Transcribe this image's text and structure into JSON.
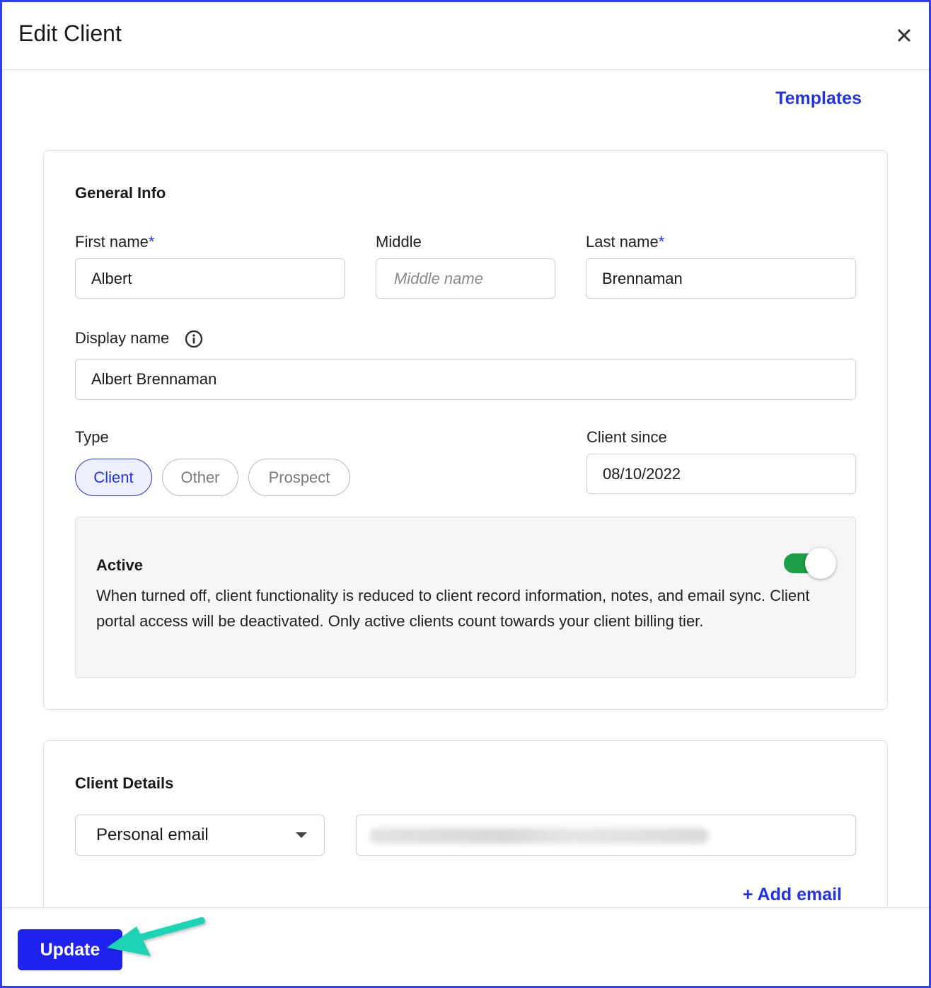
{
  "dialog": {
    "title": "Edit Client",
    "close_icon": "close-icon"
  },
  "templates_link": "Templates",
  "general_info": {
    "title": "General Info",
    "first_name": {
      "label": "First name",
      "required_mark": "*",
      "value": "Albert"
    },
    "middle": {
      "label": "Middle",
      "value": "",
      "placeholder": "Middle name"
    },
    "last_name": {
      "label": "Last name",
      "required_mark": "*",
      "value": "Brennaman"
    },
    "display_name": {
      "label": "Display name",
      "info_icon": "info-icon",
      "value": "Albert Brennaman"
    },
    "type": {
      "label": "Type",
      "options": [
        "Client",
        "Other",
        "Prospect"
      ],
      "selected": "Client"
    },
    "client_since": {
      "label": "Client since",
      "value": "08/10/2022"
    },
    "active": {
      "title": "Active",
      "description": "When turned off, client functionality is reduced to client record information, notes, and email sync. Client portal access will be deactivated. Only active clients count towards your client billing tier.",
      "enabled": true
    }
  },
  "client_details": {
    "title": "Client Details",
    "email_type": {
      "selected": "Personal email"
    },
    "add_email": "+ Add email"
  },
  "footer": {
    "update_label": "Update"
  },
  "colors": {
    "accent": "#2233e6",
    "button": "#1f22ef",
    "toggle_on": "#1e9e47",
    "annotation_arrow": "#1ed3b5",
    "frame_border": "#2f3ff0"
  }
}
